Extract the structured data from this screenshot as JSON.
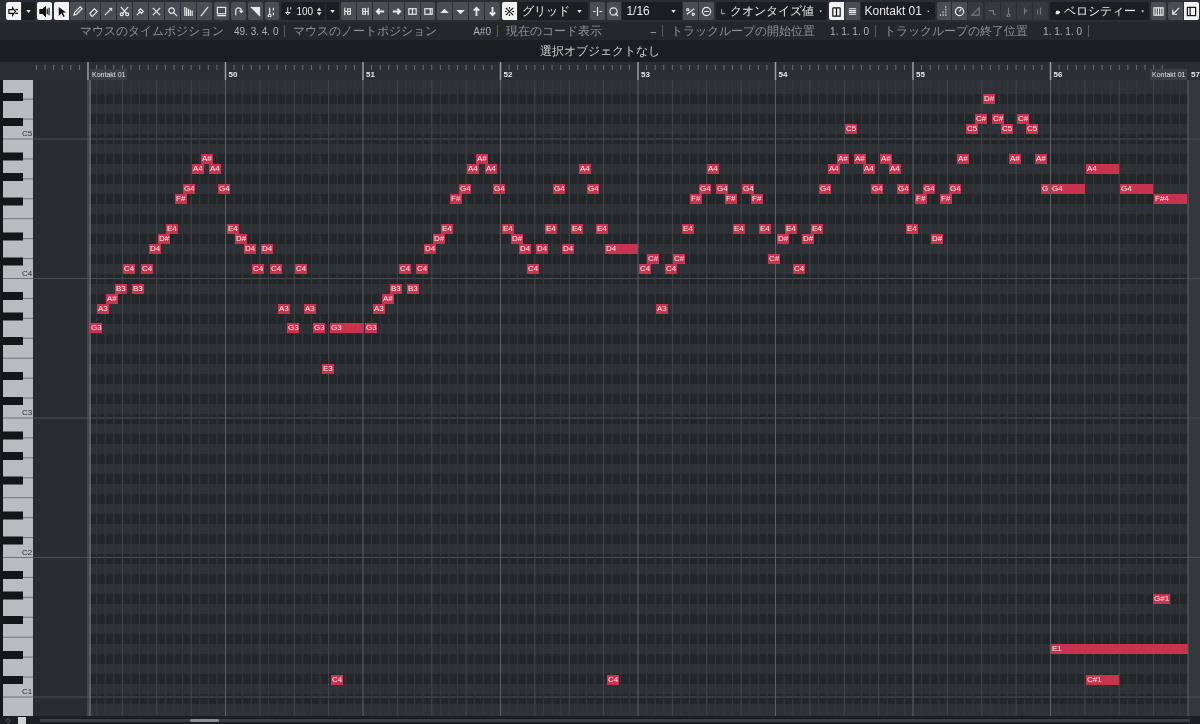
{
  "toolbar": [
    [
      {
        "kind": "button",
        "on": true,
        "disabled": false
      },
      {
        "kind": "menu"
      }
    ],
    [
      {
        "kind": "button",
        "on": true,
        "disabled": false
      }
    ],
    [
      {
        "kind": "button",
        "on": true,
        "disabled": false
      },
      {
        "kind": "button",
        "on": false,
        "disabled": false
      },
      {
        "kind": "button",
        "on": false,
        "disabled": false
      },
      {
        "kind": "button",
        "on": false,
        "disabled": false
      },
      {
        "kind": "button",
        "on": false,
        "disabled": false
      },
      {
        "kind": "button",
        "on": false,
        "disabled": false
      },
      {
        "kind": "button",
        "on": false,
        "disabled": false
      },
      {
        "kind": "button",
        "on": false,
        "disabled": false
      },
      {
        "kind": "button",
        "on": false,
        "disabled": false
      },
      {
        "kind": "button",
        "on": false,
        "disabled": false
      }
    ],
    [
      {
        "kind": "button",
        "on": false,
        "disabled": false
      }
    ],
    [
      {
        "kind": "button",
        "on": false,
        "disabled": false
      }
    ],
    [
      {
        "kind": "button",
        "on": false,
        "disabled": false
      }
    ],
    [
      {
        "kind": "button",
        "on": false,
        "disabled": false
      }
    ],
    [
      {
        "kind": "spinner",
        "value": "100"
      },
      {
        "kind": "menu"
      }
    ],
    [
      {
        "kind": "button",
        "on": false,
        "disabled": false
      },
      {
        "kind": "button",
        "on": false,
        "disabled": false
      },
      {
        "kind": "button",
        "on": false,
        "disabled": false
      },
      {
        "kind": "button",
        "on": false,
        "disabled": false
      },
      {
        "kind": "button",
        "on": false,
        "disabled": false
      },
      {
        "kind": "button",
        "on": false,
        "disabled": false
      }
    ],
    [
      {
        "kind": "button",
        "on": false,
        "disabled": false
      },
      {
        "kind": "button",
        "on": false,
        "disabled": false
      },
      {
        "kind": "button",
        "on": false,
        "disabled": false
      },
      {
        "kind": "button",
        "on": false,
        "disabled": false
      }
    ],
    [
      {
        "kind": "button",
        "on": true,
        "disabled": false
      },
      {
        "kind": "dropdown",
        "value": "グリッド"
      }
    ],
    [
      {
        "kind": "button",
        "on": false,
        "disabled": false
      }
    ],
    [
      {
        "kind": "button",
        "on": false,
        "disabled": false
      },
      {
        "kind": "dropdown",
        "value": "1/16"
      },
      {
        "kind": "button",
        "on": false,
        "disabled": false
      },
      {
        "kind": "button",
        "on": false,
        "disabled": false
      }
    ],
    [
      {
        "kind": "dropdown",
        "value": "クオンタイズ値"
      }
    ],
    [
      {
        "kind": "button",
        "on": true,
        "disabled": false
      },
      {
        "kind": "button",
        "on": false,
        "disabled": false
      },
      {
        "kind": "dropdown",
        "value": "Kontakt 01"
      }
    ],
    [
      {
        "kind": "button",
        "on": false,
        "disabled": false
      },
      {
        "kind": "button",
        "on": false,
        "disabled": false
      },
      {
        "kind": "button",
        "on": false,
        "disabled": true
      }
    ],
    [
      {
        "kind": "button",
        "on": false,
        "disabled": true
      },
      {
        "kind": "button",
        "on": false,
        "disabled": true
      },
      {
        "kind": "button",
        "on": false,
        "disabled": true
      },
      {
        "kind": "button",
        "on": false,
        "disabled": true
      }
    ],
    [
      {
        "kind": "dropdown",
        "value": "ベロシティー"
      }
    ],
    [
      {
        "kind": "button",
        "on": false,
        "disabled": false
      }
    ],
    [
      {
        "kind": "button",
        "on": false,
        "disabled": false
      },
      {
        "kind": "button",
        "on": true,
        "disabled": false
      }
    ]
  ],
  "info_bar": [
    {
      "label": "マウスのタイムポジション",
      "value": "49. 3. 4. 0"
    },
    {
      "label": "マウスのノートポジション",
      "value": "A#0"
    },
    {
      "label": "現在のコード表示",
      "value": "–"
    },
    {
      "label": "トラックループの開始位置",
      "value": "1. 1. 1. 0"
    },
    {
      "label": "トラックループの終了位置",
      "value": "1. 1. 1. 0"
    }
  ],
  "selection": "選択オブジェクトなし",
  "ruler": {
    "part_start": "Kontakt 01",
    "bars": [
      "50",
      "51",
      "52",
      "53",
      "54",
      "55",
      "56",
      "57"
    ],
    "part_end": "Kontakt 01"
  },
  "keyboard": {
    "labels": [
      "C5",
      "C4",
      "C3",
      "C2",
      "C1"
    ]
  },
  "notes": [
    {
      "label": "G3"
    },
    {
      "label": "A3"
    },
    {
      "label": "A#"
    },
    {
      "label": "B3"
    },
    {
      "label": "C4"
    },
    {
      "label": "B3"
    },
    {
      "label": "C4"
    },
    {
      "label": "D4"
    },
    {
      "label": "D#"
    },
    {
      "label": "E4"
    },
    {
      "label": "F#"
    },
    {
      "label": "G4"
    },
    {
      "label": "A4"
    },
    {
      "label": "A#"
    },
    {
      "label": "A4"
    },
    {
      "label": "G4"
    },
    {
      "label": "E4"
    },
    {
      "label": "D#"
    },
    {
      "label": "D4"
    },
    {
      "label": "C4"
    },
    {
      "label": "D4"
    },
    {
      "label": "C4"
    },
    {
      "label": "A3"
    },
    {
      "label": "G3"
    },
    {
      "label": "C4"
    },
    {
      "label": "A3"
    },
    {
      "label": "G3"
    },
    {
      "label": "E3"
    },
    {
      "label": "G3"
    },
    {
      "label": "C4"
    },
    {
      "label": "G3"
    },
    {
      "label": "A3"
    },
    {
      "label": "A#"
    },
    {
      "label": "B3"
    },
    {
      "label": "C4"
    },
    {
      "label": "B3"
    },
    {
      "label": "C4"
    },
    {
      "label": "D4"
    },
    {
      "label": "D#"
    },
    {
      "label": "E4"
    },
    {
      "label": "F#"
    },
    {
      "label": "G4"
    },
    {
      "label": "A4"
    },
    {
      "label": "A#"
    },
    {
      "label": "A4"
    },
    {
      "label": "G4"
    },
    {
      "label": "E4"
    },
    {
      "label": "D#"
    },
    {
      "label": "D4"
    },
    {
      "label": "C4"
    },
    {
      "label": "D4"
    },
    {
      "label": "E4"
    },
    {
      "label": "G4"
    },
    {
      "label": "D4"
    },
    {
      "label": "E4"
    },
    {
      "label": "A4"
    },
    {
      "label": "G4"
    },
    {
      "label": "E4"
    },
    {
      "label": "D4"
    },
    {
      "label": "C4"
    },
    {
      "label": "C4"
    },
    {
      "label": "C#"
    },
    {
      "label": "A3"
    },
    {
      "label": "C4"
    },
    {
      "label": "C#"
    },
    {
      "label": "E4"
    },
    {
      "label": "F#"
    },
    {
      "label": "G4"
    },
    {
      "label": "A4"
    },
    {
      "label": "G4"
    },
    {
      "label": "F#"
    },
    {
      "label": "E4"
    },
    {
      "label": "G4"
    },
    {
      "label": "F#"
    },
    {
      "label": "E4"
    },
    {
      "label": "C#"
    },
    {
      "label": "D#"
    },
    {
      "label": "E4"
    },
    {
      "label": "C4"
    },
    {
      "label": "D#"
    },
    {
      "label": "E4"
    },
    {
      "label": "G4"
    },
    {
      "label": "A4"
    },
    {
      "label": "A#"
    },
    {
      "label": "C5"
    },
    {
      "label": "A#"
    },
    {
      "label": "A4"
    },
    {
      "label": "G4"
    },
    {
      "label": "A#"
    },
    {
      "label": "A4"
    },
    {
      "label": "G4"
    },
    {
      "label": "E4"
    },
    {
      "label": "F#"
    },
    {
      "label": "G4"
    },
    {
      "label": "D#"
    },
    {
      "label": "F#"
    },
    {
      "label": "G4"
    },
    {
      "label": "A#"
    },
    {
      "label": "C5"
    },
    {
      "label": "C#"
    },
    {
      "label": "D#"
    },
    {
      "label": "C#"
    },
    {
      "label": "C5"
    },
    {
      "label": "A#"
    },
    {
      "label": "C#"
    },
    {
      "label": "C5"
    },
    {
      "label": "A#"
    },
    {
      "label": "G"
    },
    {
      "label": "G4"
    },
    {
      "label": "E1"
    },
    {
      "label": "A4"
    },
    {
      "label": "C#1"
    },
    {
      "label": "G4"
    },
    {
      "label": "F#4"
    },
    {
      "label": "G#1"
    }
  ]
}
